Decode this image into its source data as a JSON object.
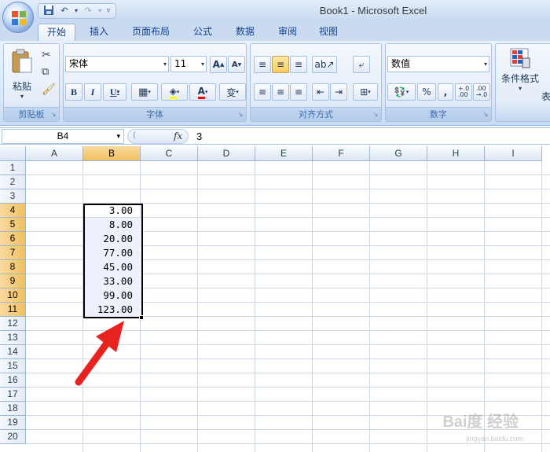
{
  "window": {
    "title": "Book1 - Microsoft Excel"
  },
  "qat": {
    "icons": [
      "save-icon",
      "undo-icon",
      "redo-icon",
      "customize-icon"
    ]
  },
  "tabs": [
    "开始",
    "插入",
    "页面布局",
    "公式",
    "数据",
    "审阅",
    "视图"
  ],
  "active_tab": "开始",
  "ribbon": {
    "clipboard": {
      "label": "剪贴板",
      "paste_label": "粘贴"
    },
    "font": {
      "label": "字体",
      "font_name": "宋体",
      "font_size": "11",
      "grow": "A",
      "shrink": "A",
      "bold": "B",
      "italic": "I",
      "underline": "U",
      "font_color_letter": "A",
      "phonetic_char": "变"
    },
    "alignment": {
      "label": "对齐方式"
    },
    "number": {
      "label": "数字",
      "format": "数值",
      "percent": "%",
      "comma": ",",
      "dec_inc": "+.0\n.00",
      "dec_dec": ".00\n→.0"
    },
    "styles": {
      "conditional_format": "条件格式",
      "truncated": "表"
    }
  },
  "formula_bar": {
    "name_box": "B4",
    "fx": "fx",
    "content": "3"
  },
  "columns": [
    "A",
    "B",
    "C",
    "D",
    "E",
    "F",
    "G",
    "H",
    "I"
  ],
  "selected_column": "B",
  "rows": [
    "1",
    "2",
    "3",
    "4",
    "5",
    "6",
    "7",
    "8",
    "9",
    "10",
    "11",
    "12",
    "13",
    "14",
    "15",
    "16",
    "17",
    "18",
    "19",
    "20"
  ],
  "selected_rows": [
    "4",
    "5",
    "6",
    "7",
    "8",
    "9",
    "10",
    "11"
  ],
  "cells_B": [
    {
      "row": "4",
      "value": "3.00"
    },
    {
      "row": "5",
      "value": "8.00"
    },
    {
      "row": "6",
      "value": "20.00"
    },
    {
      "row": "7",
      "value": "77.00"
    },
    {
      "row": "8",
      "value": "45.00"
    },
    {
      "row": "9",
      "value": "33.00"
    },
    {
      "row": "10",
      "value": "99.00"
    },
    {
      "row": "11",
      "value": "123.00"
    }
  ],
  "watermark": {
    "text": "Bai度 经验",
    "sub": "jingyan.baidu.com"
  },
  "colors": {
    "arrow": "#e8231f",
    "selection_border": "#000000",
    "header_selected": "#f1c15f"
  }
}
